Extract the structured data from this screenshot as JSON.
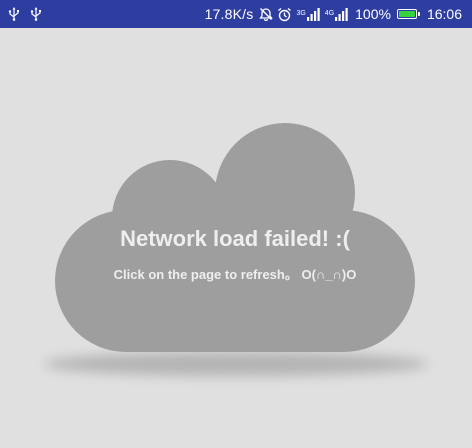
{
  "status_bar": {
    "left_icons": [
      "usb-icon",
      "usb-icon"
    ],
    "net_speed": "17.8K/s",
    "icons": [
      "mute-icon",
      "alarm-icon"
    ],
    "signal_1_label": "3G",
    "signal_2_label": "4G",
    "battery_percent": "100%",
    "battery_level": 1.0,
    "time": "16:06",
    "background_color": "#2e3ea0"
  },
  "error_page": {
    "title": "Network load failed! :(",
    "subtitle": "Click on the page to refresh。 O(∩_∩)O",
    "cloud_color": "#9e9e9e",
    "background_color": "#e0e0e0",
    "text_color": "#eeeeee"
  }
}
